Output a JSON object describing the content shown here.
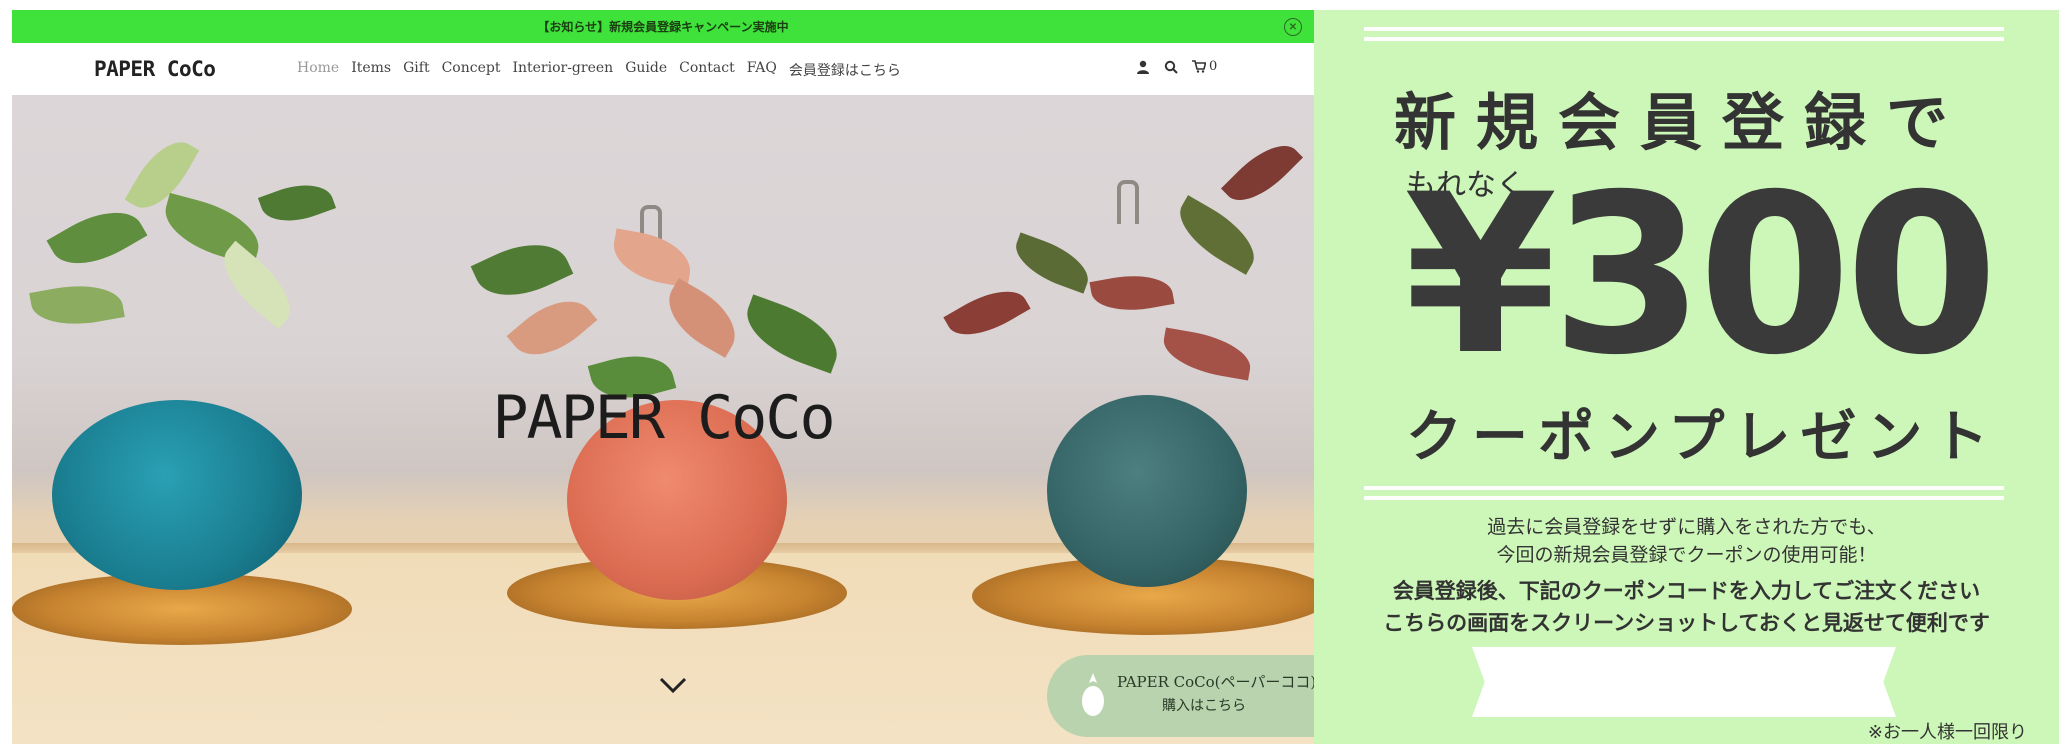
{
  "announcement": {
    "text": "【お知らせ】新規会員登録キャンペーン実施中",
    "close_icon": "circle-x-icon"
  },
  "header": {
    "logo": "PAPER CoCo",
    "nav": [
      "Home",
      "Items",
      "Gift",
      "Concept",
      "Interior-green",
      "Guide",
      "Contact",
      "FAQ",
      "会員登録はこちら"
    ],
    "cart_count": "0",
    "icons": [
      "user-icon",
      "search-icon",
      "cart-icon"
    ]
  },
  "hero": {
    "title": "PAPER CoCo",
    "scroll_icon": "chevron-down-icon"
  },
  "buy_pill": {
    "line1": "PAPER CoCo(ペーパーココ)",
    "line2": "購入はこちら",
    "icon": "pineapple-icon"
  },
  "promo": {
    "headline": "新規会員登録で",
    "subhead": "もれなく",
    "amount": "¥300",
    "coupon": "クーポンプレゼント",
    "para1": "過去に会員登録をせずに購入をされた方でも、",
    "para2": "今回の新規会員登録でクーポンの使用可能！",
    "para3": "会員登録後、下記のクーポンコードを入力してご注文ください",
    "para4": "こちらの画面をスクリーンショットしておくと見返せて便利です",
    "note": "※お一人様一回限り"
  },
  "colors": {
    "announce_bar": "#3ee23a",
    "promo_bg": "#cdf7b8",
    "pill_bg": "#b9d3af"
  }
}
